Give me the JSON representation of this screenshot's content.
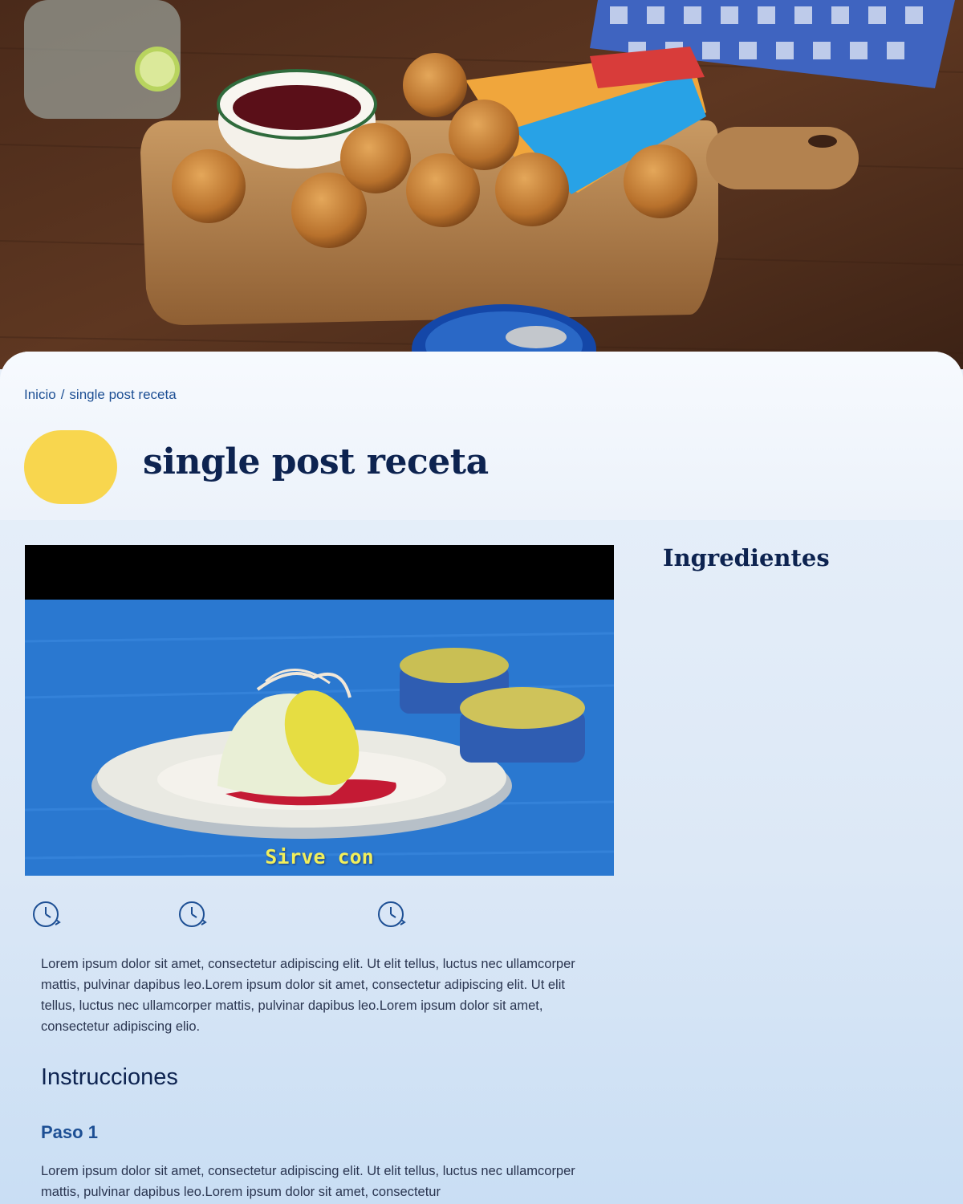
{
  "hero": {
    "image_alt": "Croquetas de atún sobre tabla de madera"
  },
  "breadcrumb": {
    "home_label": "Inicio",
    "separator": "/",
    "current_label": "single post receta"
  },
  "page": {
    "title": "single post receta"
  },
  "video": {
    "caption": "Sirve con"
  },
  "meta": {
    "icons": [
      "clock-icon",
      "clock-icon",
      "clock-icon"
    ]
  },
  "content": {
    "intro": "Lorem ipsum dolor sit amet, consectetur adipiscing elit. Ut elit tellus, luctus nec ullamcorper mattis, pulvinar dapibus leo.Lorem ipsum dolor sit amet, consectetur adipiscing elit. Ut elit tellus, luctus nec ullamcorper mattis, pulvinar dapibus leo.Lorem ipsum dolor sit amet, consectetur adipiscing elio.",
    "instructions_title": "Instrucciones",
    "steps": [
      {
        "title": "Paso 1",
        "text": "Lorem ipsum dolor sit amet, consectetur adipiscing elit. Ut elit tellus, luctus nec ullamcorper mattis, pulvinar dapibus leo.Lorem ipsum dolor sit amet, consectetur"
      }
    ]
  },
  "sidebar": {
    "ingredients_title": "Ingredientes"
  },
  "colors": {
    "brand_navy": "#0d2350",
    "link_blue": "#1d4f94",
    "accent_yellow": "#f8d64e",
    "panel_bg": "#e5eef9",
    "video_bg": "#2a78d0"
  }
}
